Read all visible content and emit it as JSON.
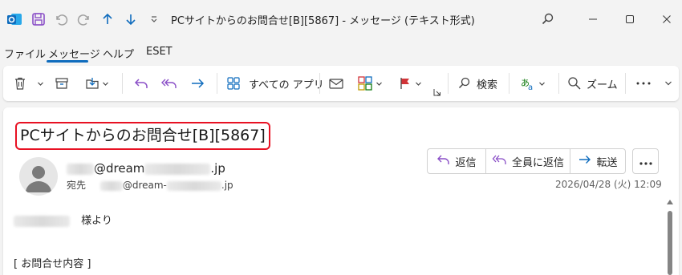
{
  "window": {
    "title": "PCサイトからのお問合せ[B][5867]  -  メッセージ (テキスト形式)"
  },
  "menu": {
    "items": [
      "ファイル",
      "メッセージ",
      "ヘルプ",
      "ESET"
    ],
    "active": "メッセージ"
  },
  "ribbon": {
    "all_apps_label": "すべての アプリ",
    "search_label": "検索",
    "zoom_label": "ズーム"
  },
  "message": {
    "subject": "PCサイトからのお問合せ[B][5867]",
    "from_visible_part": "@dream",
    "from_suffix": ".jp",
    "to_label": "宛先",
    "to_visible_part": "@dream-",
    "to_suffix": ".jp",
    "timestamp": "2026/04/28 (火) 12:09",
    "body_line1_suffix": "様より",
    "body_line2": "[ お問合せ内容 ]"
  },
  "actions": {
    "reply": "返信",
    "reply_all": "全員に返信",
    "forward": "転送"
  },
  "colors": {
    "accent": "#0f6cbd",
    "subject_highlight": "#e81123",
    "chrome_bg": "#f3f3f3"
  }
}
